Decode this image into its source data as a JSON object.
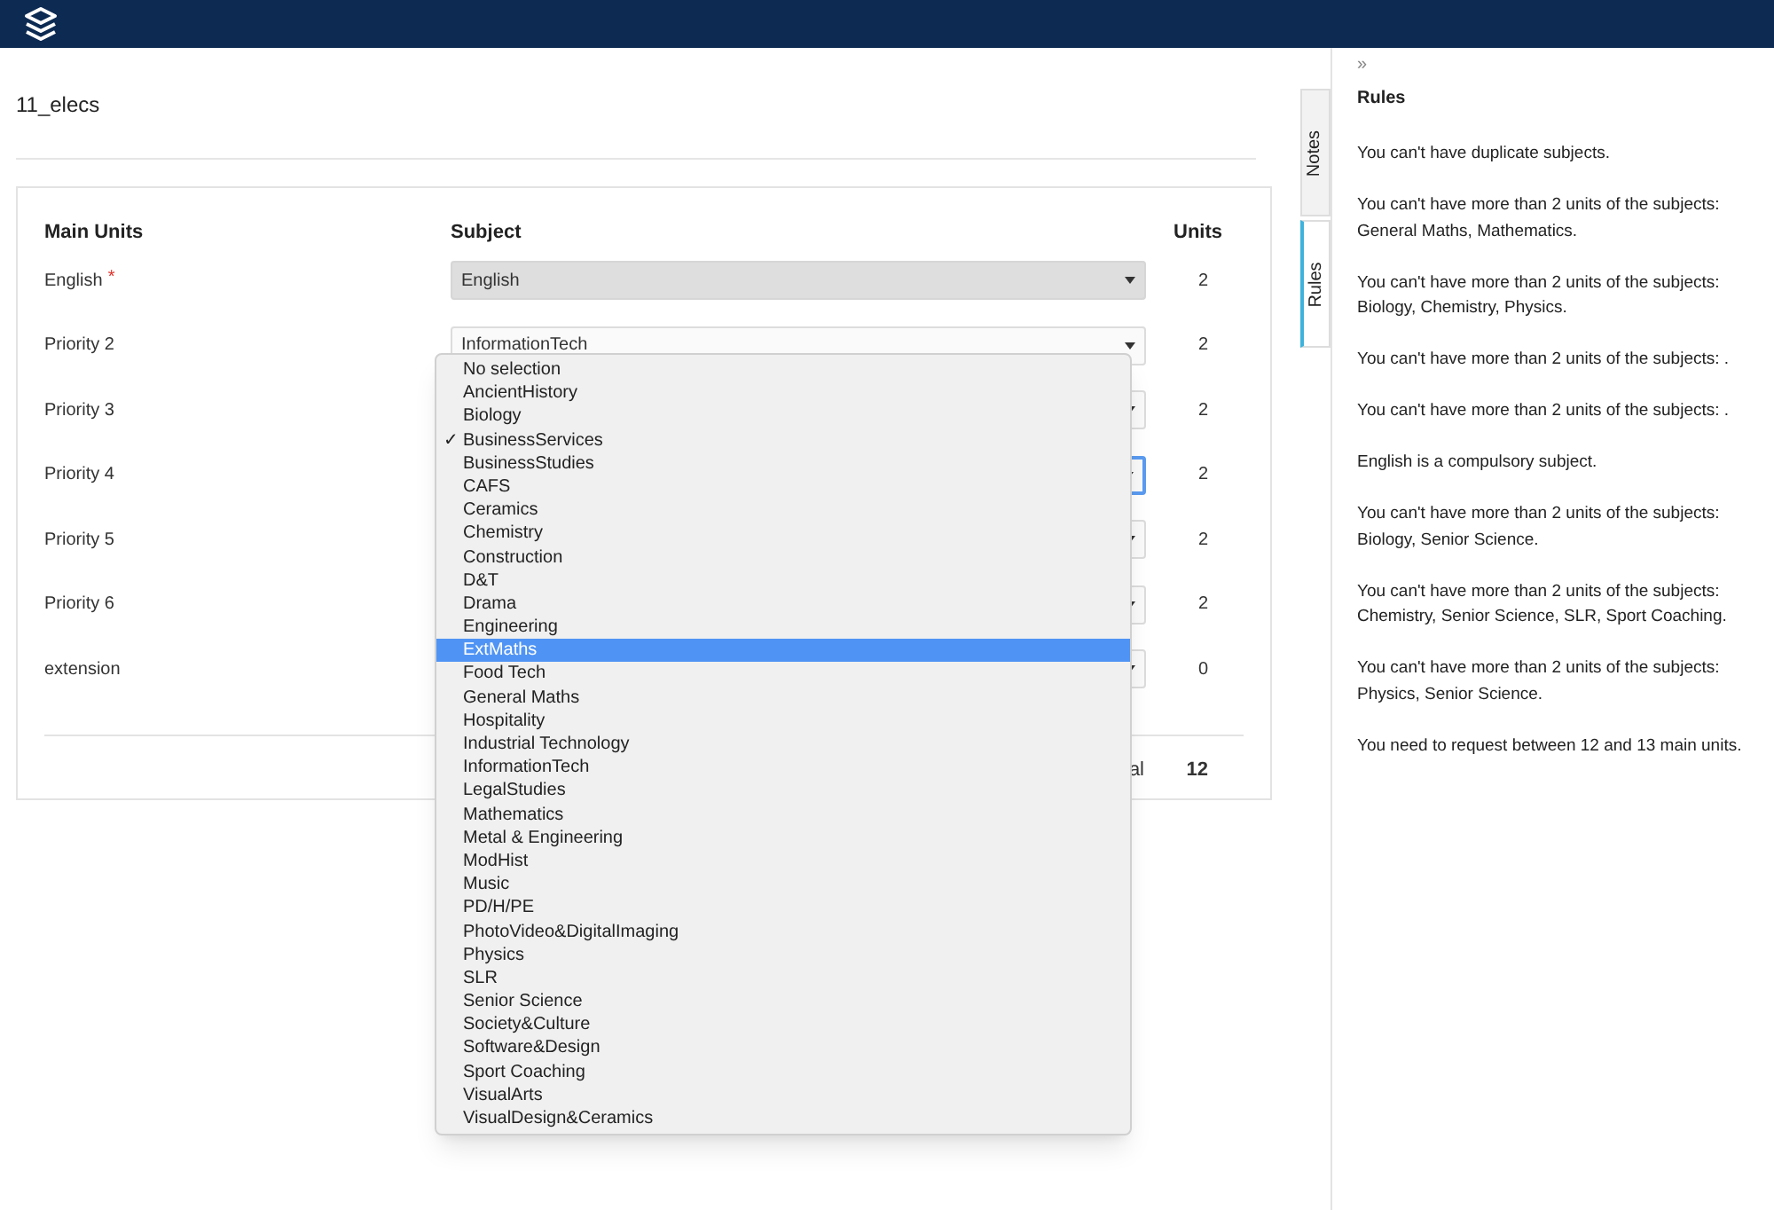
{
  "page": {
    "title": "11_elecs"
  },
  "table": {
    "columns": [
      "Main Units",
      "Subject",
      "Units"
    ],
    "rows": [
      {
        "label": "English",
        "required": true,
        "subject": "English",
        "disabled": true,
        "focused": false,
        "units": "2"
      },
      {
        "label": "Priority 2",
        "required": false,
        "subject": "InformationTech",
        "disabled": false,
        "focused": false,
        "units": "2"
      },
      {
        "label": "Priority 3",
        "required": false,
        "disabled": false,
        "focused": false,
        "units": "2"
      },
      {
        "label": "Priority 4",
        "required": false,
        "disabled": false,
        "focused": true,
        "units": "2"
      },
      {
        "label": "Priority 5",
        "required": false,
        "disabled": false,
        "focused": false,
        "units": "2"
      },
      {
        "label": "Priority 6",
        "required": false,
        "disabled": false,
        "focused": false,
        "units": "2"
      },
      {
        "label": "extension",
        "required": false,
        "disabled": false,
        "focused": false,
        "units": "0"
      }
    ],
    "required_mark": "*",
    "total": {
      "label": "al",
      "value": "12"
    }
  },
  "dropdown": {
    "check_mark": "✓",
    "options": [
      {
        "label": "No selection",
        "selected": false,
        "highlighted": false
      },
      {
        "label": "AncientHistory",
        "selected": false,
        "highlighted": false
      },
      {
        "label": "Biology",
        "selected": false,
        "highlighted": false
      },
      {
        "label": "BusinessServices",
        "selected": true,
        "highlighted": false
      },
      {
        "label": "BusinessStudies",
        "selected": false,
        "highlighted": false
      },
      {
        "label": "CAFS",
        "selected": false,
        "highlighted": false
      },
      {
        "label": "Ceramics",
        "selected": false,
        "highlighted": false
      },
      {
        "label": "Chemistry",
        "selected": false,
        "highlighted": false
      },
      {
        "label": "Construction",
        "selected": false,
        "highlighted": false
      },
      {
        "label": "D&T",
        "selected": false,
        "highlighted": false
      },
      {
        "label": "Drama",
        "selected": false,
        "highlighted": false
      },
      {
        "label": "Engineering",
        "selected": false,
        "highlighted": false
      },
      {
        "label": "ExtMaths",
        "selected": false,
        "highlighted": true
      },
      {
        "label": "Food Tech",
        "selected": false,
        "highlighted": false
      },
      {
        "label": "General Maths",
        "selected": false,
        "highlighted": false
      },
      {
        "label": "Hospitality",
        "selected": false,
        "highlighted": false
      },
      {
        "label": "Industrial Technology",
        "selected": false,
        "highlighted": false
      },
      {
        "label": "InformationTech",
        "selected": false,
        "highlighted": false
      },
      {
        "label": "LegalStudies",
        "selected": false,
        "highlighted": false
      },
      {
        "label": "Mathematics",
        "selected": false,
        "highlighted": false
      },
      {
        "label": "Metal & Engineering",
        "selected": false,
        "highlighted": false
      },
      {
        "label": "ModHist",
        "selected": false,
        "highlighted": false
      },
      {
        "label": "Music",
        "selected": false,
        "highlighted": false
      },
      {
        "label": "PD/H/PE",
        "selected": false,
        "highlighted": false
      },
      {
        "label": "PhotoVideo&DigitalImaging",
        "selected": false,
        "highlighted": false
      },
      {
        "label": "Physics",
        "selected": false,
        "highlighted": false
      },
      {
        "label": "SLR",
        "selected": false,
        "highlighted": false
      },
      {
        "label": "Senior Science",
        "selected": false,
        "highlighted": false
      },
      {
        "label": "Society&Culture",
        "selected": false,
        "highlighted": false
      },
      {
        "label": "Software&Design",
        "selected": false,
        "highlighted": false
      },
      {
        "label": "Sport Coaching",
        "selected": false,
        "highlighted": false
      },
      {
        "label": "VisualArts",
        "selected": false,
        "highlighted": false
      },
      {
        "label": "VisualDesign&Ceramics",
        "selected": false,
        "highlighted": false
      }
    ]
  },
  "side_tabs": [
    {
      "label": "Notes",
      "selected": false
    },
    {
      "label": "Rules",
      "selected": true
    }
  ],
  "rules_panel": {
    "collapse": "»",
    "title": "Rules",
    "rules": [
      "You can't have duplicate subjects.",
      "You can't have more than 2 units of the subjects: General Maths, Mathematics.",
      "You can't have more than 2 units of the subjects: Biology, Chemistry, Physics.",
      "You can't have more than 2 units of the subjects: .",
      "You can't have more than 2 units of the subjects: .",
      "English is a compulsory subject.",
      "You can't have more than 2 units of the subjects: Biology, Senior Science.",
      "You can't have more than 2 units of the subjects: Chemistry, Senior Science, SLR, Sport Coaching.",
      "You can't have more than 2 units of the subjects: Physics, Senior Science.",
      "You need to request between 12 and 13 main units."
    ]
  }
}
